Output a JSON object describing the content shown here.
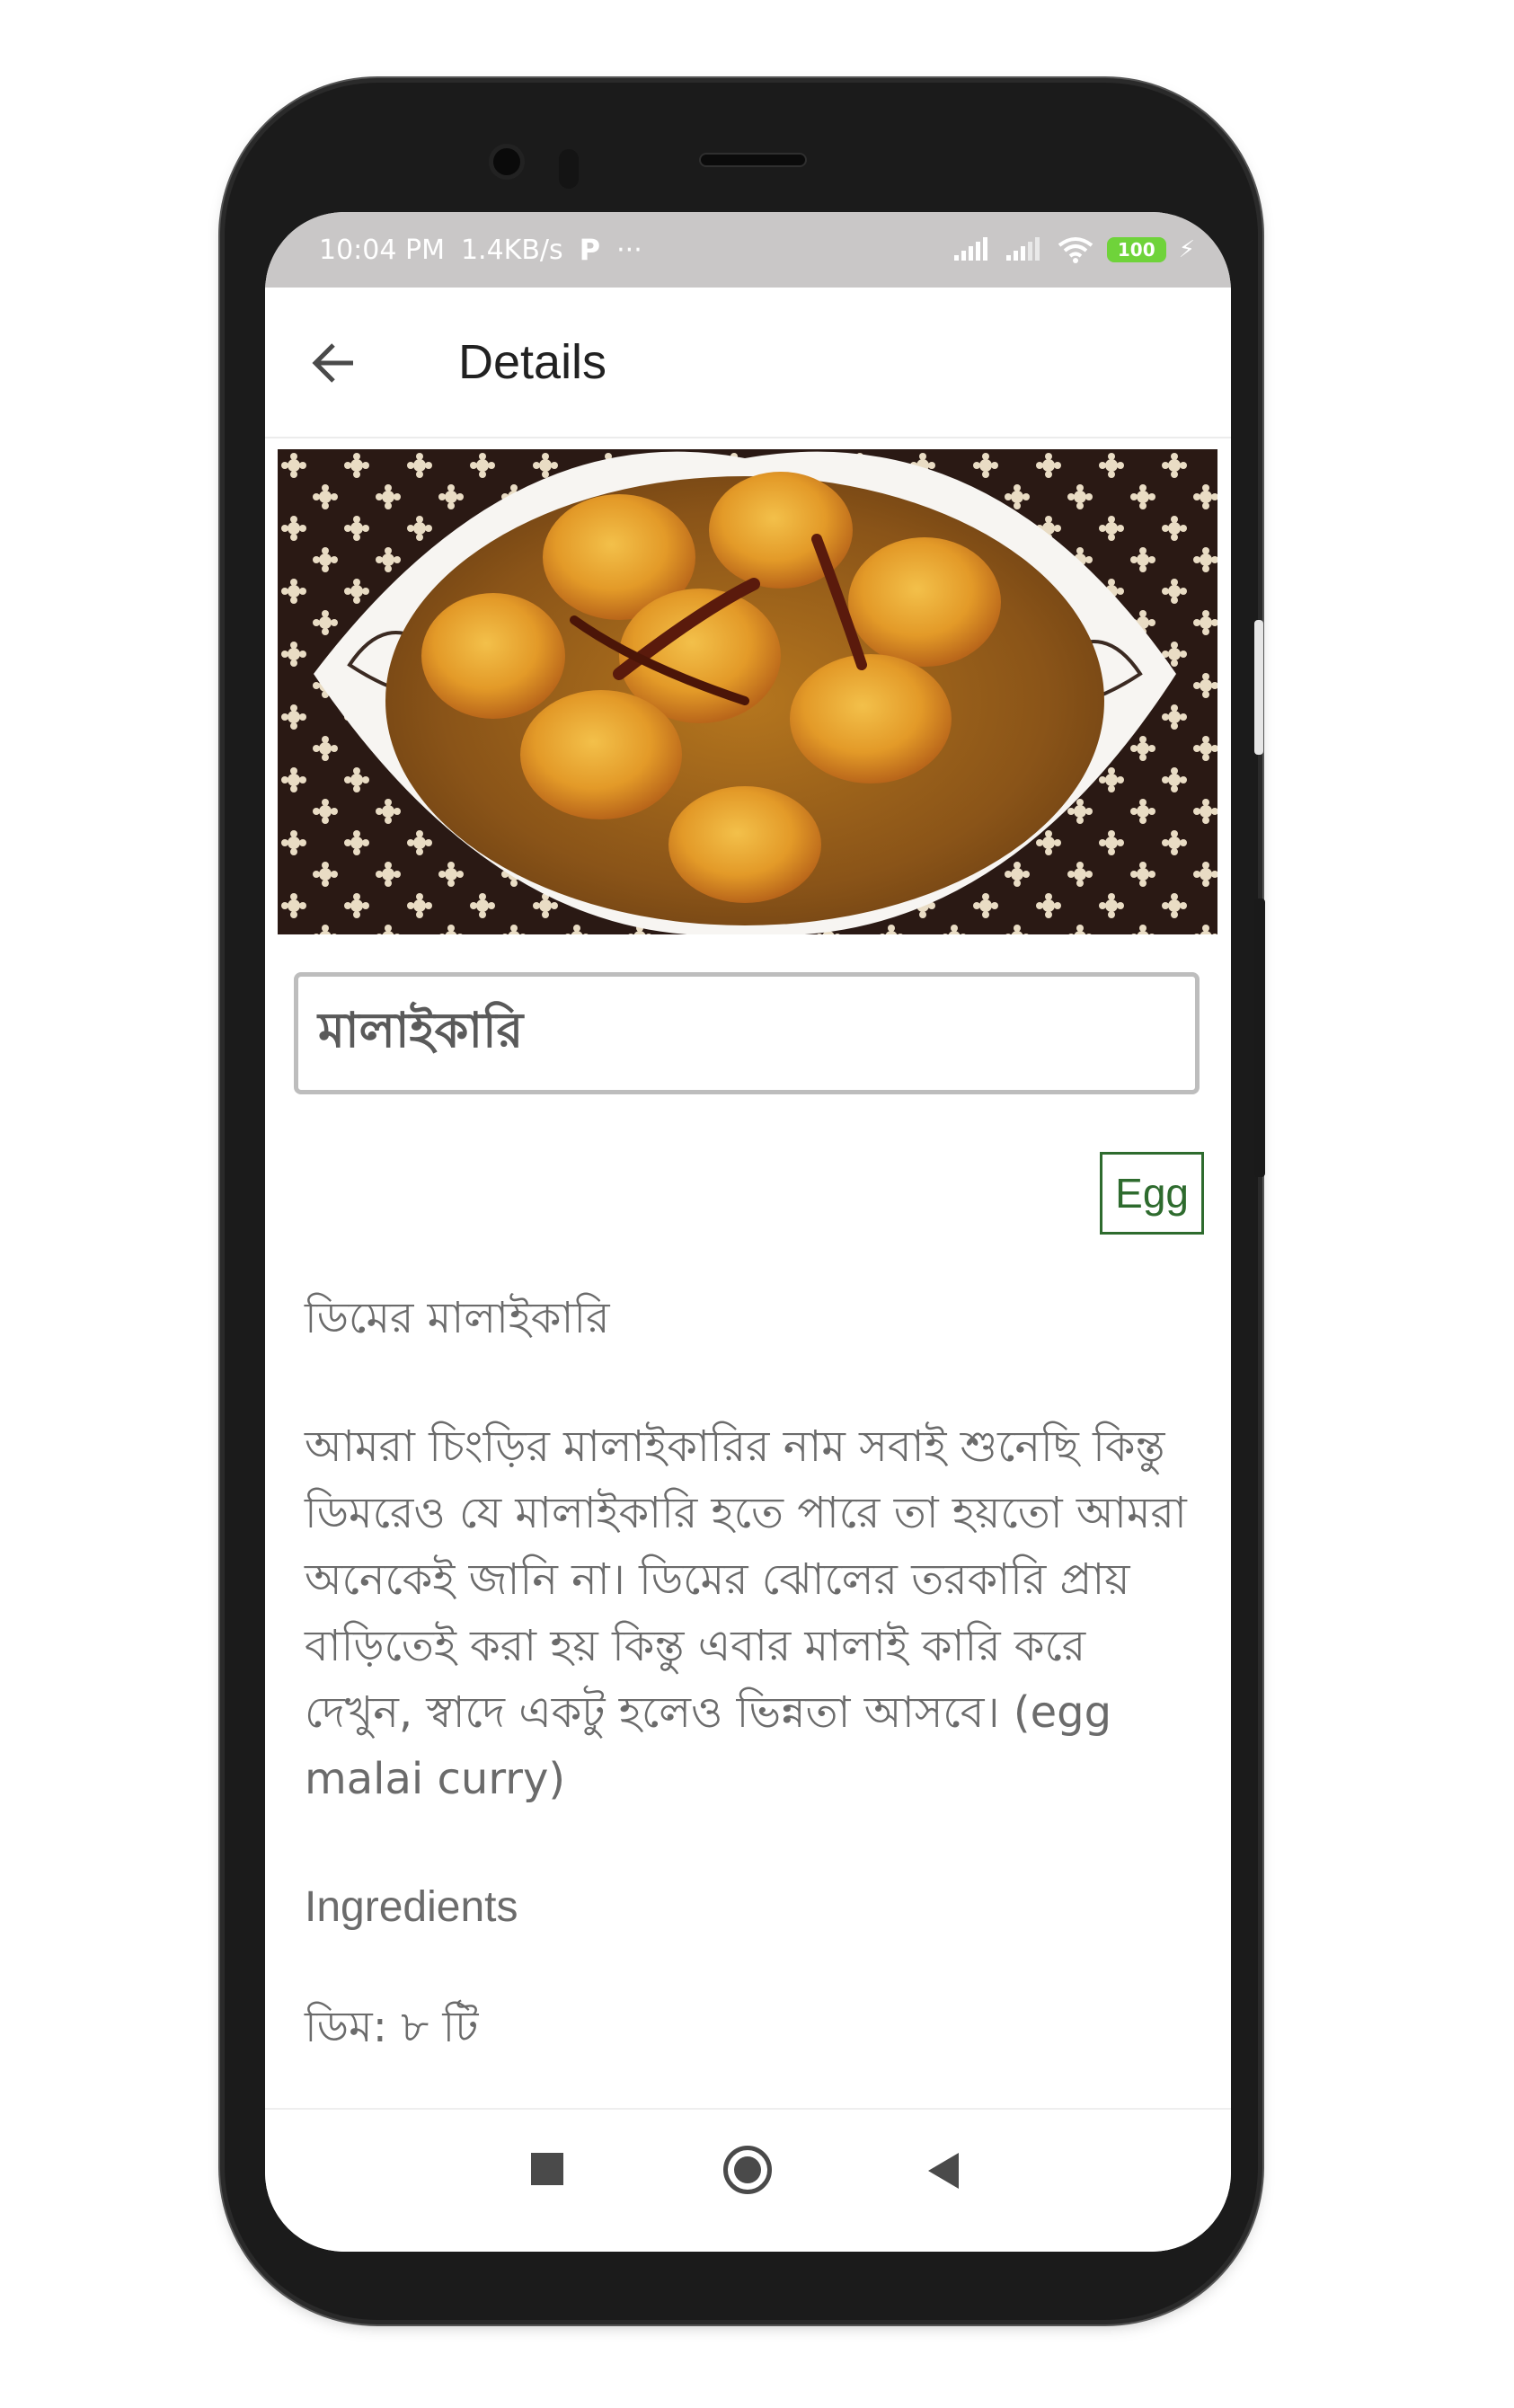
{
  "status_bar": {
    "time": "10:04 PM",
    "net_speed": "1.4KB/s",
    "p_label": "P",
    "dots": "···",
    "battery": "100",
    "bolt": "⚡"
  },
  "app_bar": {
    "title": "Details"
  },
  "recipe": {
    "name": "মালাইকারি",
    "category_chip": "Egg",
    "subtitle": "ডিমের মালাইকারি",
    "description": "আমরা চিংড়ির মালাইকারির নাম সবাই শুনেছি কিন্তু ডিমরেও যে মালাইকারি হতে পারে তা হয়তো আমরা অনেকেই জানি না। ডিমের ঝোলের তরকারি প্রায় বাড়িতেই করা হয় কিন্তু এবার মালাই কারি করে দেখুন, স্বাদে একটু হলেও ভিন্নতা আসবে। (egg malai curry)",
    "ingredients_heading": "Ingredients",
    "ingredient_first": "ডিম: ৮ টি"
  },
  "colors": {
    "status_bar_bg": "#c9c7c7",
    "chip_green": "#2e6b2e",
    "battery_green": "#6fd33a",
    "body_text": "#6b6b6b"
  },
  "icons": {
    "back": "arrow-left-icon",
    "nav_recents": "square-icon",
    "nav_home": "circle-icon",
    "nav_back": "triangle-back-icon"
  }
}
